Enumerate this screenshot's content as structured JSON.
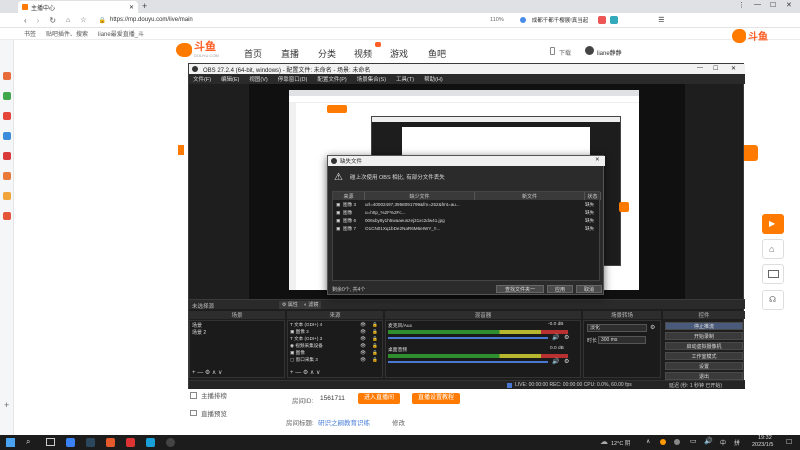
{
  "browser": {
    "tab_title": "主播中心",
    "url": "https://mp.douyu.com/live/main",
    "zoom": "110%",
    "news": "成都千都千樱展!真当起",
    "bookmarks": [
      "书签",
      "贴吧插件、搜索",
      "liane最爱直播_斗"
    ]
  },
  "site": {
    "logo": "斗鱼",
    "logo_sub": "DOUYU.COM",
    "nav": [
      "首页",
      "直播",
      "分类",
      "视频",
      "游戏",
      "鱼吧"
    ],
    "download": "下载",
    "user": "liane静静"
  },
  "obs": {
    "title": "OBS 27.2.4 (64-bit, windows) - 配置文件: 未命名 - 场景: 未命名",
    "menu": [
      "文件(F)",
      "编辑(E)",
      "视图(V)",
      "停靠窗口(D)",
      "配置文件(P)",
      "场景集合(S)",
      "工具(T)",
      "帮助(H)"
    ],
    "no_source": "未选择源",
    "props_btn": "属性",
    "filter_btn": "滤镜",
    "docks": {
      "scenes": "场景",
      "sources": "来源",
      "mixer": "混音器",
      "transitions": "场景转场",
      "controls": "控件"
    },
    "scenes": [
      "场景",
      "场景 2"
    ],
    "sources": [
      "文本 (GDI+) 4",
      "图像 3",
      "文本 (GDI+) 3",
      "视频采集设备",
      "图像",
      "窗口采集 3"
    ],
    "mixer": [
      {
        "name": "麦克风/Aux",
        "level": "-0.0 dB"
      },
      {
        "name": "桌面音频",
        "level": "0.0 dB"
      }
    ],
    "transition_label": "淡化",
    "duration_label": "时长",
    "duration_value": "300 ms",
    "controls": [
      "停止推流",
      "开始录制",
      "启动虚拟摄像机",
      "工作室模式",
      "设置",
      "退出"
    ],
    "status": "LIVE: 00:00:00   REC: 00:00:00   CPU: 0.0%, 60.00 fps",
    "status_right": "延迟 (秒: 1 秒钟 已开始)"
  },
  "dialog": {
    "title": "缺失文件",
    "message": "碰上次使用 OBS 相比, 有部分文件丢失",
    "columns": [
      "来源",
      "缺少文件",
      "新文件",
      "状态"
    ],
    "rows": [
      {
        "source": "图像 3",
        "file": "url=40002497,3958091799&fm=252&fmt=au...",
        "status": "缺失"
      },
      {
        "source": "图像",
        "file": "u=http_%2F%2Fc...",
        "status": "缺失"
      },
      {
        "source": "图像 6",
        "file": "006xby8y1h5waaeuszej31xc2dw41.jpg",
        "status": "缺失"
      },
      {
        "source": "图像 7",
        "file": "O1CN01Xq1bDe2NaR6M6eIWY_!!...",
        "status": "缺失"
      }
    ],
    "footer": "剩余0个, 共4个",
    "buttons": [
      "查找文件夹一",
      "应用",
      "取消"
    ]
  },
  "page": {
    "left_items": [
      "主播排榜",
      "直播预览"
    ],
    "room_id_label": "房间ID:",
    "room_id": "1561711",
    "enter_room": "进入直播间",
    "live_settings": "直播设置教程",
    "room_title_label": "房间标题:",
    "room_title": "研识之嗣教育识练",
    "modify": "修改"
  },
  "taskbar": {
    "weather": "12°C 阴",
    "time": "19:32",
    "date": "2023/1/5"
  }
}
